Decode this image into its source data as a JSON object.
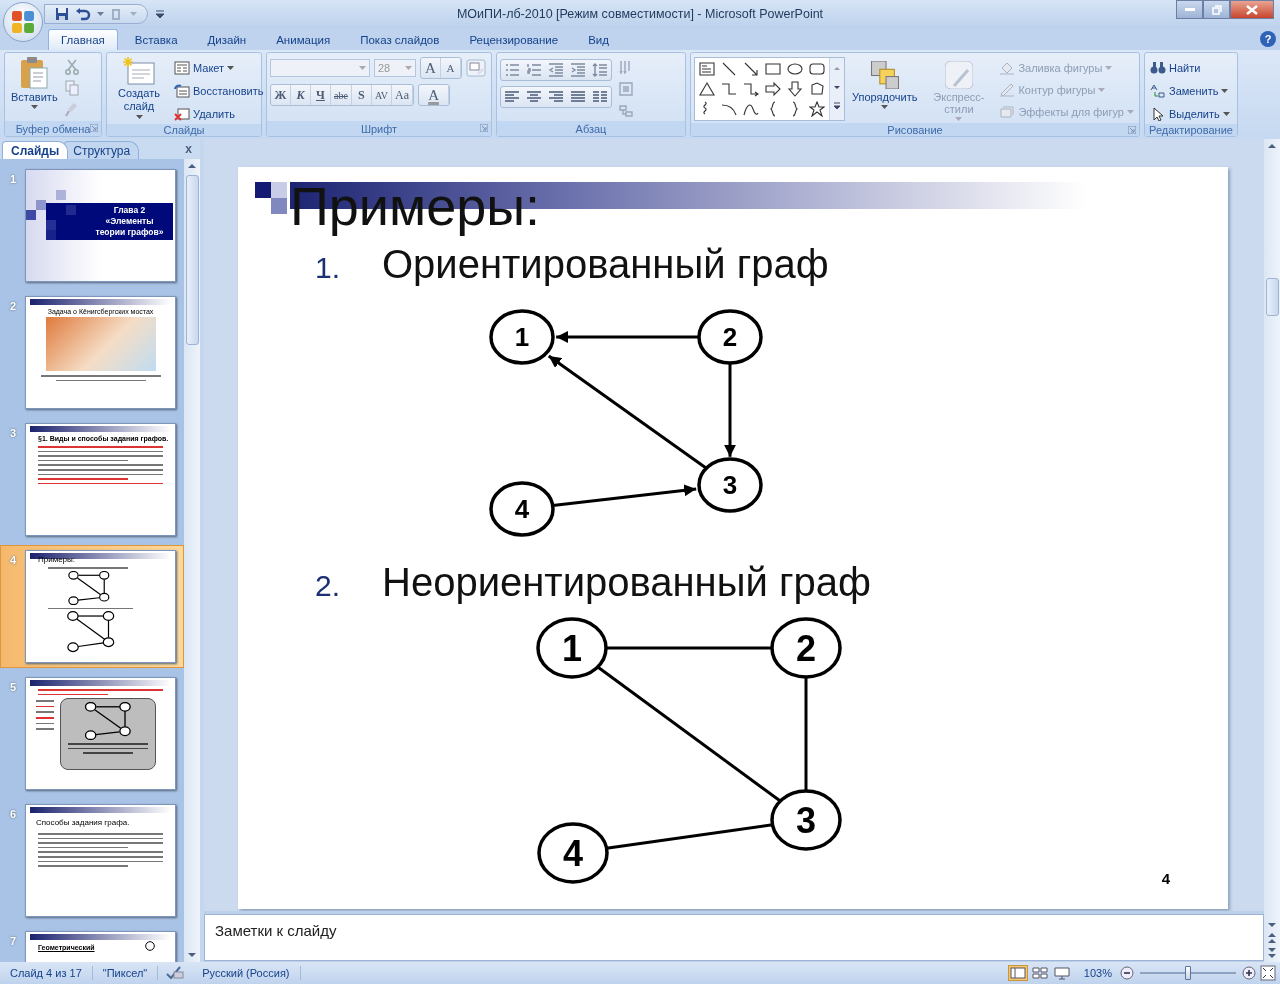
{
  "window": {
    "title": "МОиПИ-лб-2010 [Режим совместимости] - Microsoft PowerPoint"
  },
  "ribbon_tabs": [
    {
      "label": "Главная",
      "selected": true
    },
    {
      "label": "Вставка",
      "selected": false
    },
    {
      "label": "Дизайн",
      "selected": false
    },
    {
      "label": "Анимация",
      "selected": false
    },
    {
      "label": "Показ слайдов",
      "selected": false
    },
    {
      "label": "Рецензирование",
      "selected": false
    },
    {
      "label": "Вид",
      "selected": false
    }
  ],
  "help_button": "?",
  "clipboard": {
    "label": "Буфер обмена",
    "paste": "Вставить"
  },
  "slides_group": {
    "label": "Слайды",
    "new_slide": "Создать слайд",
    "layout": "Макет",
    "reset": "Восстановить",
    "delete": "Удалить"
  },
  "font": {
    "label": "Шрифт",
    "size": "28",
    "grow": "A",
    "shrink": "A",
    "buttons": [
      "Ж",
      "К",
      "Ч",
      "abe",
      "S",
      "AV",
      "Aa"
    ],
    "color_button": "A"
  },
  "paragraph": {
    "label": "Абзац"
  },
  "drawing": {
    "label": "Рисование",
    "commands": [
      {
        "kind": "big",
        "label": "Упорядочить",
        "disabled": false
      },
      {
        "kind": "big",
        "label": "Экспресс-стили",
        "disabled": true
      },
      {
        "kind": "small",
        "label": "Заливка фигуры",
        "disabled": true
      },
      {
        "kind": "small",
        "label": "Контур фигуры",
        "disabled": true
      },
      {
        "kind": "small",
        "label": "Эффекты для фигур",
        "disabled": true
      }
    ]
  },
  "editing": {
    "label": "Редактирование",
    "find": "Найти",
    "replace": "Заменить",
    "select": "Выделить"
  },
  "pane_tabs": [
    {
      "label": "Слайды",
      "selected": true
    },
    {
      "label": "Структура",
      "selected": false
    }
  ],
  "pane_close": "x",
  "thumbnails": [
    {
      "number": "1",
      "kind": "title",
      "selected": false,
      "title_lines": [
        "Глава 2",
        "«Элементы",
        "теории графов»"
      ]
    },
    {
      "number": "2",
      "kind": "map",
      "selected": false,
      "title": "Задача о Кёнигсбергских мостах"
    },
    {
      "number": "3",
      "kind": "text",
      "selected": false,
      "heading": "§1. Виды и способы задания графов."
    },
    {
      "number": "4",
      "kind": "graphs",
      "selected": true,
      "title": "Примеры:"
    },
    {
      "number": "5",
      "kind": "callout",
      "selected": false
    },
    {
      "number": "6",
      "kind": "text",
      "selected": false,
      "heading": "Способы задания графа."
    },
    {
      "number": "7",
      "kind": "partial",
      "selected": false,
      "heading": "Геометрический"
    }
  ],
  "slide": {
    "title": "Примеры:",
    "page": "4",
    "items": [
      {
        "marker": "1.",
        "text": "Ориентированный граф",
        "nodes": [
          "1",
          "2",
          "3",
          "4"
        ]
      },
      {
        "marker": "2.",
        "text": "Неориентированный граф",
        "nodes": [
          "1",
          "2",
          "3",
          "4"
        ]
      }
    ]
  },
  "notes": {
    "placeholder": "Заметки к слайду"
  },
  "status_bar": {
    "slide": "Слайд 4 из 17",
    "theme": "\"Пиксел\"",
    "language": "Русский (Россия)",
    "zoom": "103%",
    "zoom_slider": {
      "level": 0.5
    }
  }
}
